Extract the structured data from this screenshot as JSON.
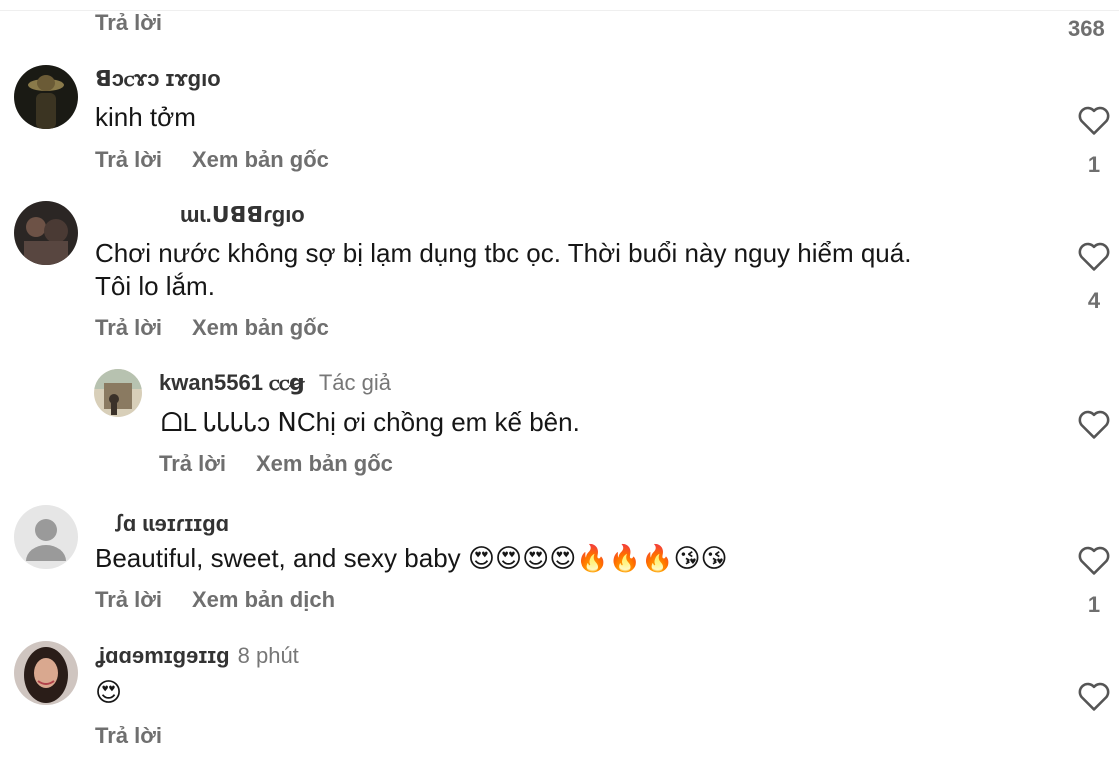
{
  "top": {
    "reply_label": "Trả lời",
    "count": "368"
  },
  "comments": [
    {
      "username": "ꓭɔꮯɤɔ ɪɤgıo",
      "text": "kinh tởm",
      "reply_label": "Trả lời",
      "view_original_label": "Xem bản gốc",
      "likes": "1"
    },
    {
      "username": "ɯɩ.ᑌꓭꓭɾɡıo",
      "text_line1": "Chơi nước không sợ bị lạm dụng tbc   ọc. Thời buổi này nguy hiểm quá.",
      "text_line2": "Tôi lo lắm.",
      "reply_label": "Trả lời",
      "view_original_label": "Xem bản gốc",
      "likes": "4"
    },
    {
      "username": "kwan5561 ꮯꮯꞡ",
      "author_tag": "Tác giả",
      "text": "ᗝL ᏓᏓᏓᏓɔ ꓠChị ơi chồng em kế bên.",
      "reply_label": "Trả lời",
      "view_original_label": "Xem bản gốc"
    },
    {
      "username": "ꭍɑ ɩɩɘɪɾɪɪɡɑ",
      "text": "Beautiful, sweet, and sexy baby",
      "emojis": "😍😍😍😍🔥🔥🔥😘😘",
      "reply_label": "Trả lời",
      "translate_label": "Xem bản dịch",
      "likes": "1"
    },
    {
      "username": "ʝɑɑɘmɪɡɘɪɪɡ",
      "time": "8 phút",
      "emoji": "😍",
      "reply_label": "Trả lời"
    }
  ]
}
